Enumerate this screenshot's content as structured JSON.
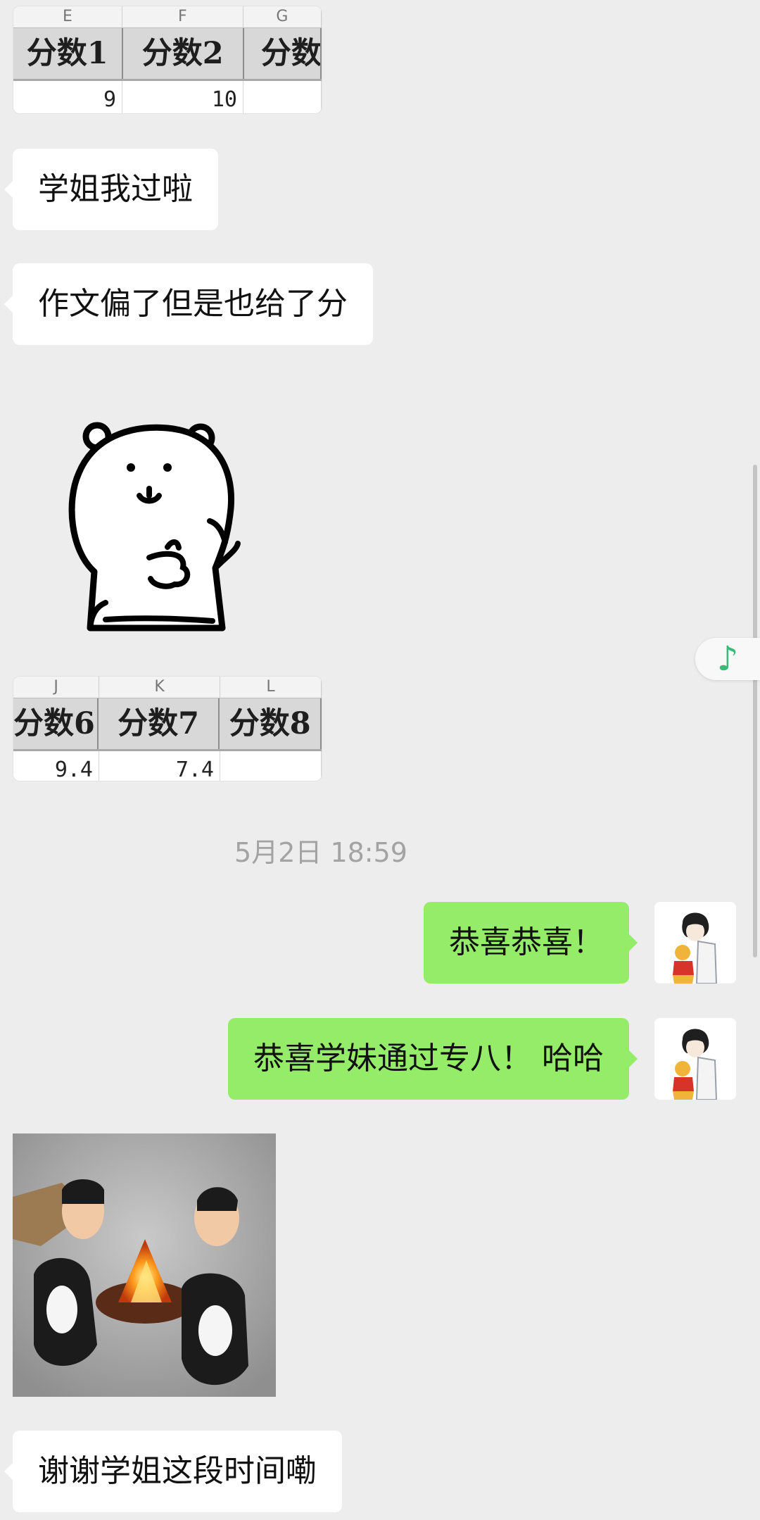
{
  "sheet1": {
    "col_letters": [
      "E",
      "F",
      "G"
    ],
    "headers": [
      "分数1",
      "分数2",
      "分数"
    ],
    "values": [
      "9",
      "10",
      ""
    ]
  },
  "sheet2": {
    "col_letters": [
      "J",
      "K",
      "L"
    ],
    "headers": [
      "分数6",
      "分数7",
      "分数8"
    ],
    "values": [
      "9.4",
      "7.4",
      ""
    ]
  },
  "messages": {
    "m1": "学姐我过啦",
    "m2": "作文偏了但是也给了分",
    "timestamp": "5月2日 18:59",
    "m3": "恭喜恭喜！",
    "m4": "恭喜学妹通过专八！ 哈哈",
    "m5": "谢谢学姐这段时间嘞"
  },
  "stickers": {
    "bear": "bear-thumbs-up-sticker",
    "cats": "cats-around-campfire-photo"
  },
  "floating": {
    "icon": "music-note-icon",
    "color": "#3cb878"
  },
  "colors": {
    "background": "#ededed",
    "outgoing_bubble": "#95ec69",
    "incoming_bubble": "#ffffff"
  }
}
